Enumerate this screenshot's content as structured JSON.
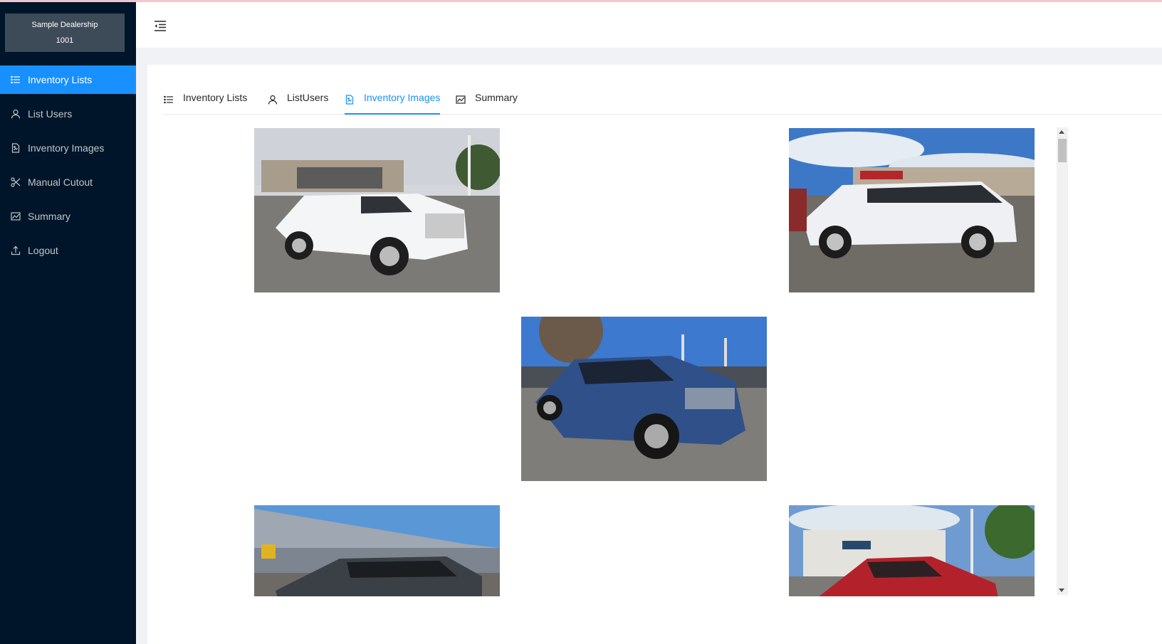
{
  "brand": {
    "name": "Sample Dealership",
    "id": "1001"
  },
  "sidebar": {
    "items": [
      {
        "label": "Inventory Lists",
        "icon": "list-icon",
        "active": true
      },
      {
        "label": "List Users",
        "icon": "user-icon",
        "active": false
      },
      {
        "label": "Inventory Images",
        "icon": "file-image-icon",
        "active": false
      },
      {
        "label": "Manual Cutout",
        "icon": "scissor-icon",
        "active": false
      },
      {
        "label": "Summary",
        "icon": "line-chart-icon",
        "active": false
      },
      {
        "label": "Logout",
        "icon": "logout-icon",
        "active": false
      }
    ]
  },
  "header": {
    "toggle_icon": "menu-fold-icon"
  },
  "tabs": [
    {
      "label": "Inventory Lists",
      "icon": "list-icon",
      "active": false
    },
    {
      "label": "ListUsers",
      "icon": "user-icon",
      "active": false
    },
    {
      "label": "Inventory Images",
      "icon": "file-image-icon",
      "active": true
    },
    {
      "label": "Summary",
      "icon": "line-chart-icon",
      "active": false
    }
  ],
  "gallery": {
    "images": [
      {
        "subject": "white pickup truck"
      },
      {
        "subject": "white SUV side view"
      },
      {
        "subject": "blue crossover SUV"
      },
      {
        "subject": "dark sedan near building"
      },
      {
        "subject": "red sedan at dealership"
      }
    ]
  },
  "colors": {
    "sidebar_bg": "#001529",
    "accent": "#1890ff",
    "brand_box": "#3d4b59"
  }
}
